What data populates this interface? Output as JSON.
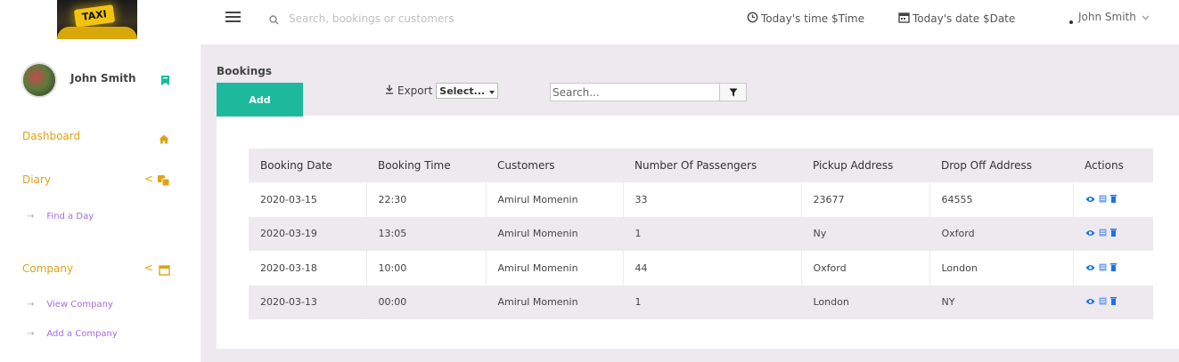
{
  "topbar": {
    "logo_text": "TAXI",
    "search_placeholder": "Search, bookings or customers",
    "time_label": "Today's time $Time",
    "date_label": "Today's date $Date",
    "user_name": "John Smith"
  },
  "sidebar": {
    "profile_name": "John Smith",
    "sections": [
      {
        "label": "Dashboard"
      },
      {
        "label": "Diary",
        "items": [
          "Find a Day"
        ]
      },
      {
        "label": "Company",
        "items": [
          "View Company",
          "Add a Company"
        ]
      }
    ],
    "arrow": "→",
    "chevron": "<"
  },
  "main": {
    "title": "Bookings",
    "add_label": "Add",
    "export_label": "Export",
    "select_value": "Select...",
    "search_placeholder": "Search...",
    "columns": [
      "Booking Date",
      "Booking Time",
      "Customers",
      "Number Of Passengers",
      "Pickup Address",
      "Drop Off Address",
      "Actions"
    ],
    "rows": [
      [
        "2020-03-15",
        "22:30",
        "Amirul Momenin",
        "33",
        "23677",
        "64555"
      ],
      [
        "2020-03-19",
        "13:05",
        "Amirul Momenin",
        "1",
        "Ny",
        "Oxford"
      ],
      [
        "2020-03-18",
        "10:00",
        "Amirul Momenin",
        "44",
        "Oxford",
        "London"
      ],
      [
        "2020-03-13",
        "00:00",
        "Amirul Momenin",
        "1",
        "London",
        "NY"
      ]
    ]
  },
  "colors": {
    "accent": "#1eb99d",
    "nav": "#e0a213",
    "sub_nav": "#a66be0",
    "action_icons": "#1a73e8",
    "main_bg": "#ede9ee"
  },
  "icons": {
    "menu": "hamburger-icon",
    "search": "search-icon",
    "clock": "clock-icon",
    "calendar": "calendar-icon",
    "user_dropdown": "chevron-down-icon",
    "bookmark": "bookmark-icon",
    "home": "home-icon",
    "diary": "diary-icon",
    "company": "calendar-icon",
    "export": "download-icon",
    "filter": "filter-icon",
    "view": "eye-icon",
    "edit": "edit-icon",
    "delete": "trash-icon"
  }
}
